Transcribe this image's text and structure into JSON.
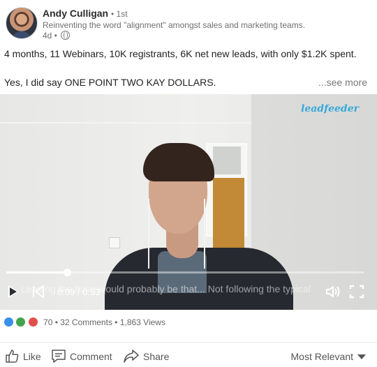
{
  "post": {
    "author": "Andy Culligan",
    "degree": "• 1st",
    "headline": "Reinventing the word \"alignment\" amongst sales and marketing teams.",
    "time": "4d •",
    "text_line1": "4 months, 11 Webinars, 10K registrants, 6K net new leads, with only $1.2K spent.",
    "text_line2": "Yes, I did say ONE POINT TWO KAY DOLLARS.",
    "see_more": "...see more"
  },
  "video": {
    "watermark": "leadfeeder",
    "caption": "Leading the thing would probably be that... Not following the typical",
    "current_time": "0:09",
    "duration": "0:53",
    "time_display": "0:09 / 0:53",
    "progress_fraction": 0.17
  },
  "social": {
    "reaction_icons": [
      "like-reaction-icon",
      "celebrate-reaction-icon",
      "love-reaction-icon"
    ],
    "reactions_count": "70",
    "comments": "32 Comments",
    "views": "1,863 Views",
    "summary": "70 • 32 Comments • 1,863 Views"
  },
  "actions": {
    "like": "Like",
    "comment": "Comment",
    "share": "Share",
    "sort": "Most Relevant"
  },
  "colors": {
    "accent_blue": "#378fe9",
    "watermark_blue": "#37a9d8",
    "celebrate_green": "#44a34d",
    "love_red": "#e0504b"
  }
}
